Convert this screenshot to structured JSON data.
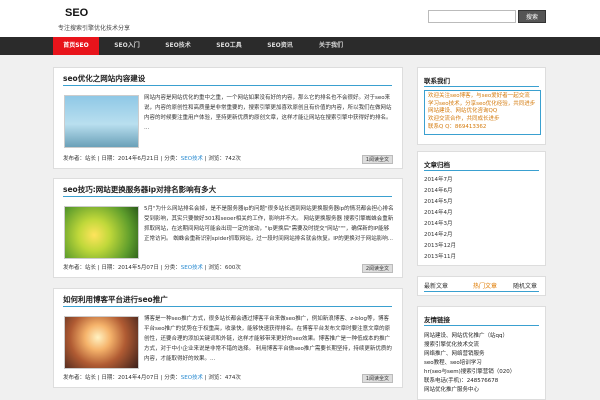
{
  "site": {
    "title": "SEO",
    "description": "专注搜索引擎优化技术分享"
  },
  "search": {
    "placeholder": "",
    "button_label": "搜索"
  },
  "nav": {
    "items": [
      {
        "label": "首页SEO",
        "active": true
      },
      {
        "label": "SEO入门",
        "active": false
      },
      {
        "label": "SEO技术",
        "active": false
      },
      {
        "label": "SEO工具",
        "active": false
      },
      {
        "label": "SEO资讯",
        "active": false
      },
      {
        "label": "关于我们",
        "active": false
      }
    ]
  },
  "posts": [
    {
      "title": "seo优化之网站内容建设",
      "excerpt": "网站内容是网站优化的重中之重，一个网站如果没有好的内容，那么它的排名也不会很好。对于seo来说，内容的原创性和高质量是非常重要的，搜索引擎更加喜欢原创且有价值的内容，所以我们在做网站内容的时候要注重用户体验，坚持更新优质的原创文章，这样才能让网站在搜索引擎中获得好的排名。 ...",
      "author": "发布者：站长",
      "date": "日期：2014年6月21日",
      "category_prefix": "分类：",
      "category": "SEO技术",
      "views": "浏览：742次",
      "more": "1阅读全文"
    },
    {
      "title": "seo技巧:网站更换服务器ip对排名影响有多大",
      "excerpt": "5月\"为什么网站排名会掉，是不是服务器ip的问题\"很多站长遇到网站更换服务器ip的情况都会担心排名受到影响，其实只要做好301和seoer相关的工作，影响并不大。 网站更换服务器 搜索引擎蜘蛛会重新抓取网站，在这期间网站可能会出现一定的波动，\"ip更换后\"需要及时提交\"网站\"\"\"，确保新的IP能够正常访问。 蜘蛛会重新识别spider抓取网站，过一段时间网站排名就会恢复。IP的更换对于网站影响...",
      "author": "发布者：站长",
      "date": "日期：2014年5月07日",
      "category_prefix": "分类：",
      "category": "SEO技术",
      "views": "浏览：600次",
      "more": "2阅读全文"
    },
    {
      "title": "如何利用博客平台进行seo推广",
      "excerpt": "博客是一种seo推广方式，很多站长都会通过博客平台来做seo推广，例如新浪博客、z-blog等，博客平台seo推广的优势在于权重高，收录快，能够快速获得排名。在博客平台发布文章时要注意文章的原创性，还要合理的添加关键词和外链，这样才能够带来更好的seo效果。博客推广是一种低成本的推广方式，对于中小企业来说是非常不错的选择。 利用博客平台做seo推广需要长期坚持，持续更新优质的内容，才能取得好的效果。...",
      "author": "发布者：站长",
      "date": "日期：2014年4月07日",
      "category_prefix": "分类：",
      "category": "SEO技术",
      "views": "浏览：474次",
      "more": "1阅读全文"
    }
  ],
  "sidebar": {
    "contact": {
      "title": "联系我们",
      "lines": [
        "欢迎关注seo博客，与seo爱好者一起交流",
        "学习seo技术，分享seo优化经验，共同进步",
        "网站建设、网站优化咨询QQ",
        "欢迎交流合作，共同成长进步",
        "联系Q Q：869413362"
      ]
    },
    "archive": {
      "title": "文章归档",
      "items": [
        "2014年7月",
        "2014年6月",
        "2014年5月",
        "2014年4月",
        "2014年3月",
        "2014年2月",
        "2013年12月",
        "2013年11月",
        "2013年10月"
      ]
    },
    "tabs": [
      {
        "label": "最新文章",
        "active": false
      },
      {
        "label": "热门文章",
        "active": true
      },
      {
        "label": "随机文章",
        "active": false
      }
    ],
    "links": {
      "title": "友情链接",
      "items": [
        "网站建设、网站优化推广（站qq）",
        "搜索引擎优化技术交流",
        "网络推广、网络营销服务",
        "seo教程、seo培训学习",
        "hr(seo与sem)搜索引擎营销（020）",
        "联系电话(手机)：248576678",
        "网站优化推广服务中心",
        "网络营销推广技术博客"
      ]
    }
  }
}
